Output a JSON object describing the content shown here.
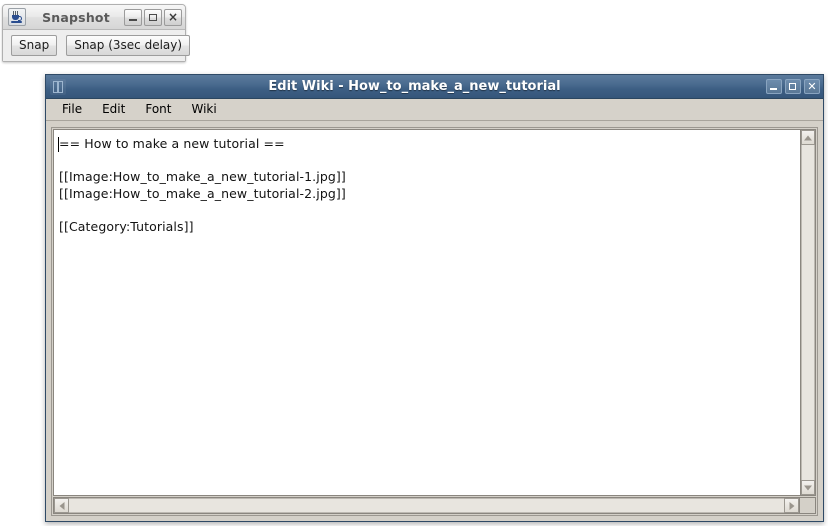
{
  "snapshot_window": {
    "title": "Snapshot",
    "app_icon": "java-coffee-cup-icon",
    "window_buttons": {
      "minimize": "minimize-icon",
      "maximize": "maximize-icon",
      "close": "×"
    },
    "buttons": [
      {
        "label": "Snap"
      },
      {
        "label": "Snap (3sec delay)"
      }
    ]
  },
  "editwiki_window": {
    "title": "Edit Wiki - How_to_make_a_new_tutorial",
    "app_icon": "window-frame-icon",
    "window_buttons": {
      "minimize": "minimize-icon",
      "maximize": "maximize-icon",
      "close": "✕"
    },
    "menubar": [
      {
        "label": "File"
      },
      {
        "label": "Edit"
      },
      {
        "label": "Font"
      },
      {
        "label": "Wiki"
      }
    ],
    "editor": {
      "lines": [
        "== How to make a new tutorial ==",
        "",
        "[[Image:How_to_make_a_new_tutorial-1.jpg]]",
        "[[Image:How_to_make_a_new_tutorial-2.jpg]]",
        "",
        "[[Category:Tutorials]]"
      ],
      "full_text": "== How to make a new tutorial ==\n\n[[Image:How_to_make_a_new_tutorial-1.jpg]]\n[[Image:How_to_make_a_new_tutorial-2.jpg]]\n\n[[Category:Tutorials]]"
    },
    "scrollbars": {
      "vertical": {
        "up_arrow": "triangle-up-icon",
        "down_arrow": "triangle-down-icon"
      },
      "horizontal": {
        "left_arrow": "triangle-left-icon",
        "right_arrow": "triangle-right-icon"
      }
    }
  },
  "colors": {
    "desktop_background": "#ffffff",
    "editwiki_titlebar": "#45688c",
    "editwiki_chrome": "#d4d0c8",
    "snapshot_chrome": "#eeeeee",
    "editor_background": "#ffffff",
    "editor_text": "#131313"
  }
}
